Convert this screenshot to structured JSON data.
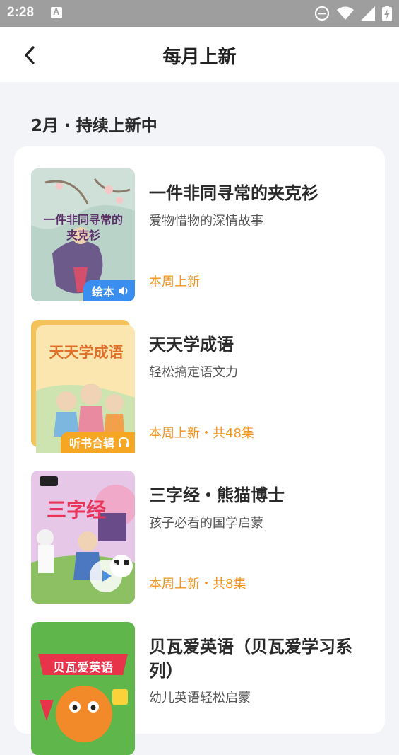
{
  "status_bar": {
    "time": "2:28",
    "icons": [
      "notification-a-icon",
      "do-not-disturb-icon",
      "wifi-icon",
      "cellular-signal-icon",
      "battery-charging-icon"
    ]
  },
  "header": {
    "back_icon": "chevron-left-icon",
    "title": "每月上新"
  },
  "section": {
    "title": "2月 · 持续上新中"
  },
  "items": [
    {
      "title": "一件非同寻常的夹克衫",
      "subtitle": "爱物惜物的深情故事",
      "tag": "本周上新",
      "badge": "绘本",
      "badge_icon": "speaker-icon",
      "cover_text": "一件非同寻常的夹克衫"
    },
    {
      "title": "天天学成语",
      "subtitle": "轻松搞定语文力",
      "tag": "本周上新・共48集",
      "badge": "听书合辑",
      "badge_icon": "headphones-icon",
      "cover_text": "天天学成语"
    },
    {
      "title": "三字经・熊猫博士",
      "subtitle": "孩子必看的国学启蒙",
      "tag": "本周上新・共8集",
      "badge": "",
      "badge_icon": "play-icon",
      "cover_text": "三字经"
    },
    {
      "title": "贝瓦爱英语（贝瓦爱学习系列）",
      "subtitle": "幼儿英语轻松启蒙",
      "tag": "",
      "badge": "",
      "badge_icon": "",
      "cover_text": "贝瓦爱英语"
    }
  ],
  "colors": {
    "accent_orange": "#f2941f",
    "badge_blue": "#3a8ef0",
    "badge_orange": "#f5a623",
    "page_bg": "#f3f4f8"
  }
}
